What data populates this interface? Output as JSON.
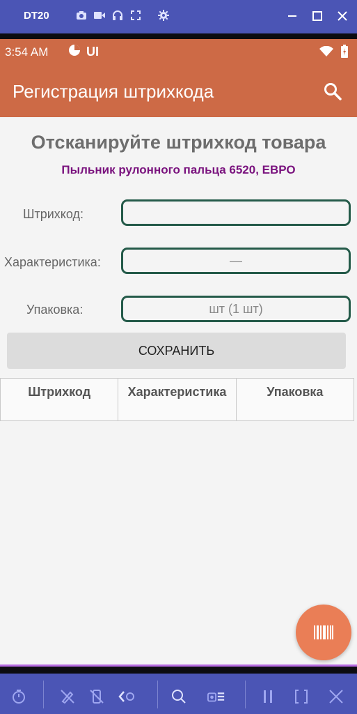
{
  "emulator": {
    "name": "DT20",
    "toolbar_icons": [
      "camera-icon",
      "video-icon",
      "headphones-icon",
      "fullscreen-icon",
      "settings-icon"
    ],
    "window_controls": [
      "minimize-icon",
      "maximize-icon",
      "close-icon"
    ],
    "bottom_icons": [
      "timer-icon",
      "pen-off-icon",
      "phone-off-icon",
      "back-settings-icon",
      "search-edit-icon",
      "camera-menu-icon",
      "pause-icon",
      "bracket-icon",
      "close-icon"
    ]
  },
  "status_bar": {
    "time": "3:54 AM",
    "ui_label": "UI"
  },
  "app_bar": {
    "title": "Регистрация штрихкода"
  },
  "main": {
    "heading": "Отсканируйте штрихкод товара",
    "product_name": "Пыльник рулонного пальца 6520, ЕВРО",
    "fields": [
      {
        "label": "Штрихкод:",
        "value": ""
      },
      {
        "label": "Характеристика:",
        "value": "—"
      },
      {
        "label": "Упаковка:",
        "value": "шт (1 шт)"
      }
    ],
    "save_label": "СОХРАНИТЬ",
    "table_headers": [
      "Штрихкод",
      "Характеристика",
      "Упаковка"
    ]
  },
  "colors": {
    "emulator_bar": "#4b55b5",
    "app_bar": "#cd6a46",
    "fab": "#ea7e56",
    "input_border": "#245a49",
    "product_text": "#7a137e"
  }
}
